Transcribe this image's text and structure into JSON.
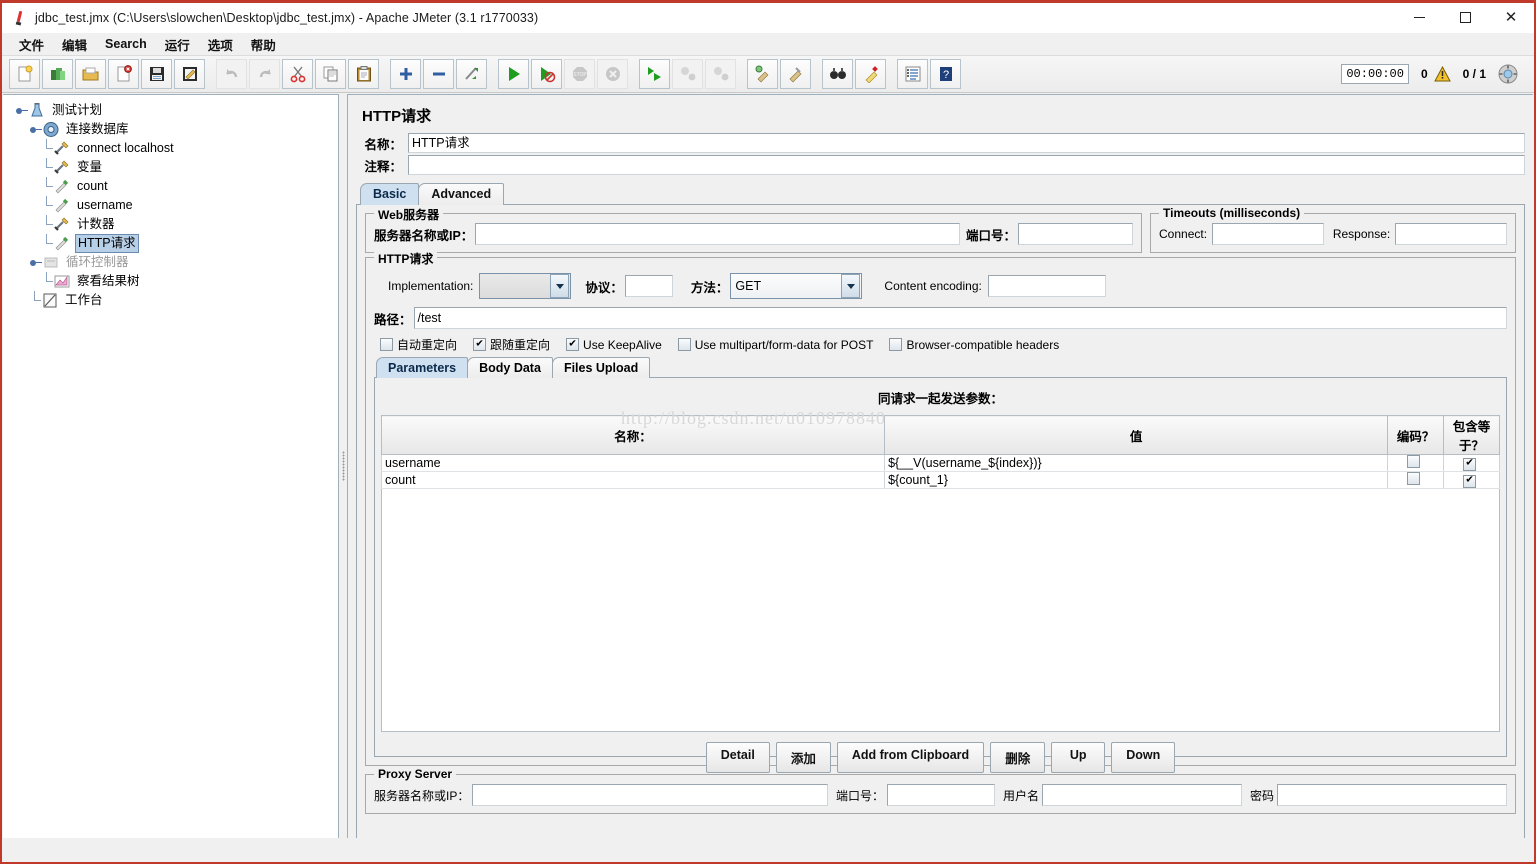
{
  "window": {
    "title": "jdbc_test.jmx (C:\\Users\\slowchen\\Desktop\\jdbc_test.jmx) - Apache JMeter (3.1 r1770033)",
    "app_icon": "jmeter-feather-icon",
    "minimize": "—",
    "maximize": "□",
    "close": "✕"
  },
  "menu": {
    "items": [
      "文件",
      "编辑",
      "Search",
      "运行",
      "选项",
      "帮助"
    ]
  },
  "toolbar": {
    "buttons": [
      {
        "name": "new-button",
        "icon": "new-document-icon",
        "enabled": true
      },
      {
        "name": "templates-button",
        "icon": "templates-icon",
        "enabled": true
      },
      {
        "name": "open-button",
        "icon": "open-folder-icon",
        "enabled": true
      },
      {
        "name": "close-button",
        "icon": "close-document-icon",
        "enabled": true
      },
      {
        "name": "save-button",
        "icon": "save-floppy-icon",
        "enabled": true
      },
      {
        "name": "save-as-button",
        "icon": "save-as-icon",
        "enabled": true
      },
      {
        "name": "undo-button",
        "icon": "undo-arrow-icon",
        "enabled": false
      },
      {
        "name": "redo-button",
        "icon": "redo-arrow-icon",
        "enabled": false
      },
      {
        "name": "cut-button",
        "icon": "scissors-icon",
        "enabled": true
      },
      {
        "name": "copy-button",
        "icon": "copy-pages-icon",
        "enabled": true
      },
      {
        "name": "paste-button",
        "icon": "clipboard-icon",
        "enabled": true
      },
      {
        "name": "expand-all-button",
        "icon": "plus-icon",
        "enabled": true
      },
      {
        "name": "collapse-all-button",
        "icon": "minus-icon",
        "enabled": true
      },
      {
        "name": "toggle-button",
        "icon": "toggle-pencil-icon",
        "enabled": true
      },
      {
        "name": "start-button",
        "icon": "play-green-icon",
        "enabled": true
      },
      {
        "name": "start-no-pauses-button",
        "icon": "play-no-pause-icon",
        "enabled": true
      },
      {
        "name": "stop-button",
        "icon": "stop-sign-icon",
        "enabled": false
      },
      {
        "name": "shutdown-button",
        "icon": "shutdown-x-icon",
        "enabled": false
      },
      {
        "name": "start-remote-all-button",
        "icon": "remote-start-icon",
        "enabled": true
      },
      {
        "name": "stop-remote-all-button",
        "icon": "remote-stop-icon",
        "enabled": false
      },
      {
        "name": "shutdown-remote-all-button",
        "icon": "remote-shutdown-icon",
        "enabled": false
      },
      {
        "name": "clear-button",
        "icon": "broom-clear-icon",
        "enabled": true
      },
      {
        "name": "clear-all-button",
        "icon": "broom-clear-all-icon",
        "enabled": true
      },
      {
        "name": "search-button",
        "icon": "binoculars-icon",
        "enabled": true
      },
      {
        "name": "search-reset-button",
        "icon": "brush-reset-icon",
        "enabled": true
      },
      {
        "name": "function-helper-button",
        "icon": "function-list-icon",
        "enabled": true
      },
      {
        "name": "help-button",
        "icon": "help-book-icon",
        "enabled": true
      }
    ],
    "elapsed_time": "00:00:00",
    "warning_count": "0",
    "warning_icon": "warning-triangle-icon",
    "thread_count": "0 / 1",
    "status_icon": "connection-status-icon"
  },
  "tree": {
    "nodes": [
      {
        "label": "测试计划",
        "icon": "test-plan-icon",
        "depth": 0,
        "expanded": true,
        "selected": false,
        "disabled": false
      },
      {
        "label": "连接数据库",
        "icon": "thread-group-icon",
        "depth": 1,
        "expanded": true,
        "selected": false,
        "disabled": false
      },
      {
        "label": "connect localhost",
        "icon": "config-element-icon",
        "depth": 2,
        "expanded": null,
        "selected": false,
        "disabled": false
      },
      {
        "label": "变量",
        "icon": "config-element-icon",
        "depth": 2,
        "expanded": null,
        "selected": false,
        "disabled": false
      },
      {
        "label": "count",
        "icon": "sampler-icon",
        "depth": 2,
        "expanded": null,
        "selected": false,
        "disabled": false
      },
      {
        "label": "username",
        "icon": "sampler-icon",
        "depth": 2,
        "expanded": null,
        "selected": false,
        "disabled": false
      },
      {
        "label": "计数器",
        "icon": "config-element-icon",
        "depth": 2,
        "expanded": null,
        "selected": false,
        "disabled": false
      },
      {
        "label": "HTTP请求",
        "icon": "sampler-icon",
        "depth": 2,
        "expanded": null,
        "selected": true,
        "disabled": false
      },
      {
        "label": "循环控制器",
        "icon": "controller-icon",
        "depth": 2,
        "expanded": false,
        "selected": false,
        "disabled": true
      },
      {
        "label": "察看结果树",
        "icon": "listener-icon",
        "depth": 2,
        "expanded": null,
        "selected": false,
        "disabled": false
      },
      {
        "label": "工作台",
        "icon": "workbench-icon",
        "depth": 0,
        "expanded": null,
        "selected": false,
        "disabled": false
      }
    ]
  },
  "panel": {
    "title": "HTTP请求",
    "name_label": "名称：",
    "name_value": "HTTP请求",
    "comment_label": "注释：",
    "comment_value": "",
    "tabs": [
      {
        "label": "Basic",
        "active": true
      },
      {
        "label": "Advanced",
        "active": false
      }
    ]
  },
  "web_server": {
    "group_title": "Web服务器",
    "server_label": "服务器名称或IP：",
    "server_value": "",
    "port_label": "端口号：",
    "port_value": ""
  },
  "timeouts": {
    "group_title": "Timeouts (milliseconds)",
    "connect_label": "Connect:",
    "connect_value": "",
    "response_label": "Response:",
    "response_value": ""
  },
  "http_request": {
    "group_title": "HTTP请求",
    "implementation_label": "Implementation:",
    "implementation_value": "",
    "protocol_label": "协议：",
    "protocol_value": "",
    "method_label": "方法：",
    "method_value": "GET",
    "content_encoding_label": "Content encoding:",
    "content_encoding_value": "",
    "path_label": "路径：",
    "path_value": "/test",
    "checkboxes": [
      {
        "label": "自动重定向",
        "checked": false
      },
      {
        "label": "跟随重定向",
        "checked": true
      },
      {
        "label": "Use KeepAlive",
        "checked": true
      },
      {
        "label": "Use multipart/form-data for POST",
        "checked": false
      },
      {
        "label": "Browser-compatible headers",
        "checked": false
      }
    ]
  },
  "param_tabs": [
    {
      "label": "Parameters",
      "active": true
    },
    {
      "label": "Body Data",
      "active": false
    },
    {
      "label": "Files Upload",
      "active": false
    }
  ],
  "parameters": {
    "send_with_request_label": "同请求一起发送参数：",
    "watermark": "http://blog.csdn.net/u010978840",
    "columns": [
      "名称：",
      "值",
      "编码？",
      "包含等于？"
    ],
    "rows": [
      {
        "name": "username",
        "value": "${__V(username_${index})}",
        "encode": false,
        "include_equals": true
      },
      {
        "name": "count",
        "value": "${count_1}",
        "encode": false,
        "include_equals": true
      }
    ],
    "buttons": [
      {
        "label": "Detail",
        "name": "detail-button"
      },
      {
        "label": "添加",
        "name": "add-button"
      },
      {
        "label": "Add from Clipboard",
        "name": "add-from-clipboard-button"
      },
      {
        "label": "删除",
        "name": "delete-button"
      },
      {
        "label": "Up",
        "name": "up-button"
      },
      {
        "label": "Down",
        "name": "down-button"
      }
    ]
  },
  "proxy_server": {
    "group_title": "Proxy Server",
    "server_label": "服务器名称或IP：",
    "server_value": "",
    "port_label": "端口号：",
    "port_value": "",
    "username_label": "用户名",
    "username_value": "",
    "password_label": "密码",
    "password_value": ""
  }
}
